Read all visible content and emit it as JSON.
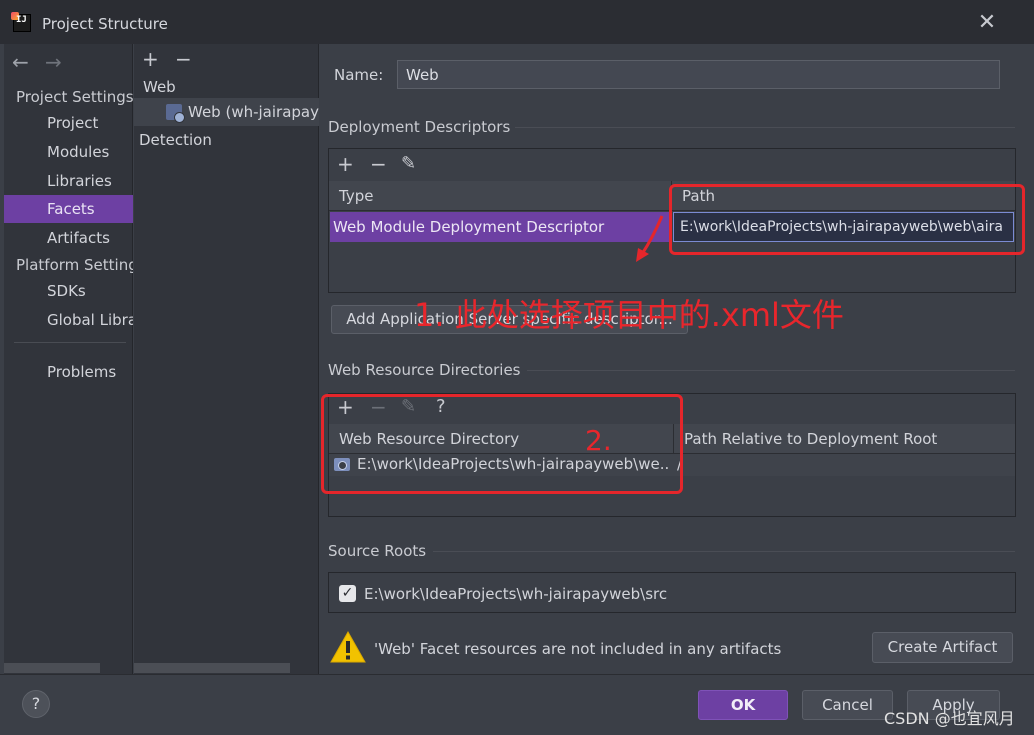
{
  "window": {
    "title": "Project Structure",
    "close": "✕"
  },
  "nav": {
    "back": "←",
    "forward": "→",
    "project_settings": "Project Settings",
    "items1": [
      "Project",
      "Modules",
      "Libraries",
      "Facets",
      "Artifacts"
    ],
    "platform_settings": "Platform Settings",
    "items2": [
      "SDKs",
      "Global Libraries"
    ],
    "problems": "Problems"
  },
  "facets": {
    "add": "+",
    "remove": "−",
    "group": "Web",
    "item": "Web (wh-jairapayweb)",
    "detection": "Detection"
  },
  "form": {
    "name_label": "Name:",
    "name_value": "Web"
  },
  "deployment": {
    "title": "Deployment Descriptors",
    "tools": [
      "+",
      "−",
      "✎"
    ],
    "col_type": "Type",
    "col_path": "Path",
    "row_type": "Web Module Deployment Descriptor",
    "row_path": "E:\\work\\IdeaProjects\\wh-jairapayweb\\web\\aira",
    "add_button": "Add Application Server specific descriptor..."
  },
  "web_resources": {
    "title": "Web Resource Directories",
    "tools": [
      "+",
      "−",
      "✎",
      "?"
    ],
    "col_dir": "Web Resource Directory",
    "col_rel": "Path Relative to Deployment Root",
    "row_dir": "E:\\work\\IdeaProjects\\wh-jairapayweb\\we...",
    "row_rel": "/"
  },
  "source_roots": {
    "title": "Source Roots",
    "checked": "✓",
    "path": "E:\\work\\IdeaProjects\\wh-jairapayweb\\src"
  },
  "warning": {
    "text": "'Web' Facet resources are not included in any artifacts",
    "button": "Create Artifact"
  },
  "buttons": {
    "help": "?",
    "ok": "OK",
    "cancel": "Cancel",
    "apply": "Apply"
  },
  "annotations": {
    "note1": "1. 此处选择项目中的.xml文件",
    "note2": "2.",
    "color": "#e5262b"
  },
  "watermark": "CSDN @也宜风月"
}
